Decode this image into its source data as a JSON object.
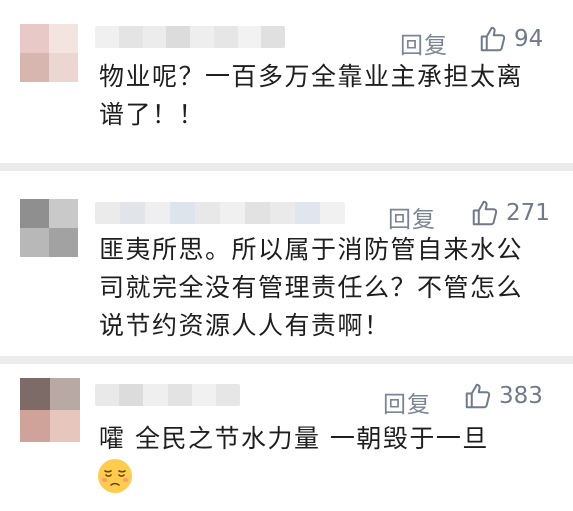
{
  "comments": [
    {
      "reply_label": "回复",
      "like_count": "94",
      "text": "物业呢？一百多万全靠业主承担太离谱了！！",
      "avatar_colors": [
        "#e9c9c7",
        "#f3e4e0",
        "#d8b6b0",
        "#ecd6d2"
      ],
      "name_colors": [
        "#f0f0f0",
        "#e4e4e4",
        "#ececec",
        "#dcdcdc",
        "#eeeeee",
        "#e6e6e6",
        "#f2f2f2",
        "#e0e0e0"
      ]
    },
    {
      "reply_label": "回复",
      "like_count": "271",
      "text": "匪夷所思。所以属于消防管自来水公司就完全没有管理责任么？不管怎么说节约资源人人有责啊！",
      "avatar_colors": [
        "#8f8f8f",
        "#c9c9c9",
        "#b8b8b8",
        "#a2a2a2"
      ],
      "name_colors": [
        "#ebebeb",
        "#e1e5ea",
        "#efefef",
        "#dde4ec",
        "#e8e8e8",
        "#f0f0f0",
        "#e2e2e2",
        "#eaeaea",
        "#dfe6ee",
        "#f1f1f1"
      ]
    },
    {
      "reply_label": "回复",
      "like_count": "383",
      "text": "嚯 全民之节水力量 一朝毁于一旦",
      "emoji": "pensive-face-emoji",
      "avatar_colors": [
        "#7d6b67",
        "#b9a9a5",
        "#cfa39a",
        "#e7c6bd"
      ],
      "name_colors": [
        "#e9e9e9",
        "#dcdcdc",
        "#efefef",
        "#e3e3e3",
        "#f1f1f1",
        "#e6e6e6"
      ]
    }
  ],
  "colors": {
    "background": "#ebebeb",
    "card": "#ffffff",
    "meta_text": "#7a8596",
    "body_text": "#1e1e1e"
  },
  "icons": {
    "like": "thumbs-up-outline-icon"
  }
}
